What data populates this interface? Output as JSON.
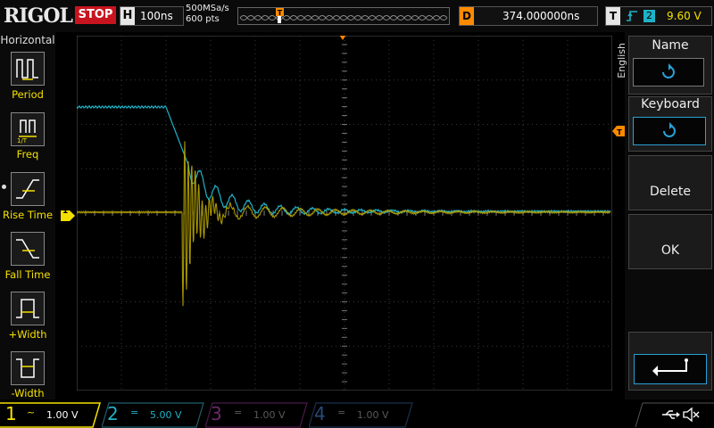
{
  "brand": "RIGOL",
  "run_state": "STOP",
  "horizontal": {
    "key": "H",
    "timebase": "100ns",
    "sample_rate": "500MSa/s",
    "points": "600 pts"
  },
  "trigger_delay": {
    "key": "D",
    "value": "374.000000ns"
  },
  "trigger": {
    "key": "T",
    "source": "2",
    "level": "9.60 V"
  },
  "left_menu": {
    "title": "Horizontal",
    "items": [
      "Period",
      "Freq",
      "Rise Time",
      "Fall Time",
      "+Width",
      "-Width"
    ]
  },
  "right_menu": {
    "language": "English",
    "name": "Name",
    "keyboard": "Keyboard",
    "delete": "Delete",
    "ok": "OK"
  },
  "channels": [
    {
      "num": "1",
      "coupling": "~",
      "scale": "1.00 V",
      "color": "#f4e000"
    },
    {
      "num": "2",
      "coupling": "=",
      "scale": "5.00 V",
      "color": "#1fb2c7"
    },
    {
      "num": "3",
      "coupling": "=",
      "scale": "1.00 V",
      "color": "#c040c0"
    },
    {
      "num": "4",
      "coupling": "=",
      "scale": "1.00 V",
      "color": "#3a7ad8"
    }
  ],
  "ch1_marker": "1",
  "colors": {
    "ch1": "#f4e000",
    "ch2": "#1fb2c7",
    "trigger": "#ff8a00",
    "stop": "#c8141e",
    "accent": "#2aa0d6"
  }
}
